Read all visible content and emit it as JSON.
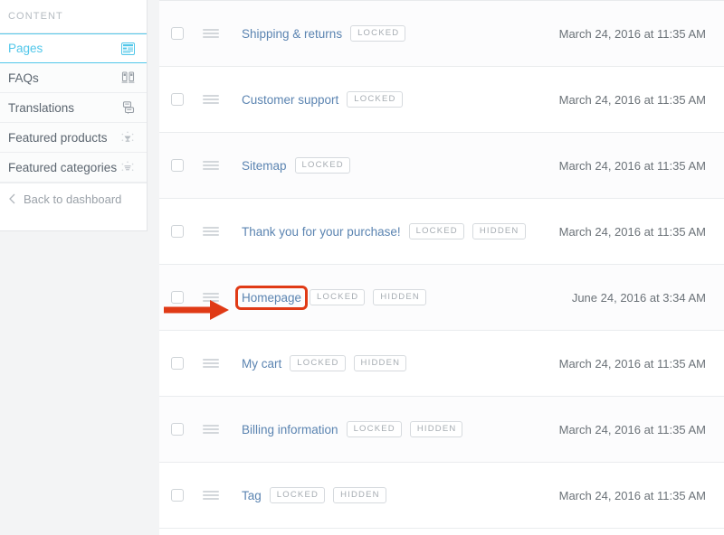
{
  "sidebar": {
    "header": "CONTENT",
    "items": [
      {
        "label": "Pages",
        "icon": "pages-icon",
        "active": true
      },
      {
        "label": "FAQs",
        "icon": "faqs-icon",
        "active": false
      },
      {
        "label": "Translations",
        "icon": "translations-icon",
        "active": false
      },
      {
        "label": "Featured products",
        "icon": "featured-products-icon",
        "active": false
      },
      {
        "label": "Featured categories",
        "icon": "featured-categories-icon",
        "active": false
      }
    ],
    "footer": {
      "label": "Back to dashboard",
      "icon": "chevron-left-icon"
    }
  },
  "table": {
    "rows": [
      {
        "title": "Shipping & returns",
        "badges": [
          "LOCKED"
        ],
        "date": "March 24, 2016 at 11:35 AM"
      },
      {
        "title": "Customer support",
        "badges": [
          "LOCKED"
        ],
        "date": "March 24, 2016 at 11:35 AM"
      },
      {
        "title": "Sitemap",
        "badges": [
          "LOCKED"
        ],
        "date": "March 24, 2016 at 11:35 AM"
      },
      {
        "title": "Thank you for your purchase!",
        "badges": [
          "LOCKED",
          "HIDDEN"
        ],
        "date": "March 24, 2016 at 11:35 AM"
      },
      {
        "title": "Homepage",
        "badges": [
          "LOCKED",
          "HIDDEN"
        ],
        "date": "June 24, 2016 at 3:34 AM"
      },
      {
        "title": "My cart",
        "badges": [
          "LOCKED",
          "HIDDEN"
        ],
        "date": "March 24, 2016 at 11:35 AM"
      },
      {
        "title": "Billing information",
        "badges": [
          "LOCKED",
          "HIDDEN"
        ],
        "date": "March 24, 2016 at 11:35 AM"
      },
      {
        "title": "Tag",
        "badges": [
          "LOCKED",
          "HIDDEN"
        ],
        "date": "March 24, 2016 at 11:35 AM"
      }
    ]
  },
  "annotation": {
    "color": "#e03a16",
    "arrow_target": "Homepage",
    "highlight_target": "Homepage"
  },
  "colors": {
    "accent": "#51c7ea",
    "link": "#5b84b1",
    "annotation": "#e03a16",
    "badge_text": "#a6acb2",
    "sidebar_text": "#5c6670"
  }
}
